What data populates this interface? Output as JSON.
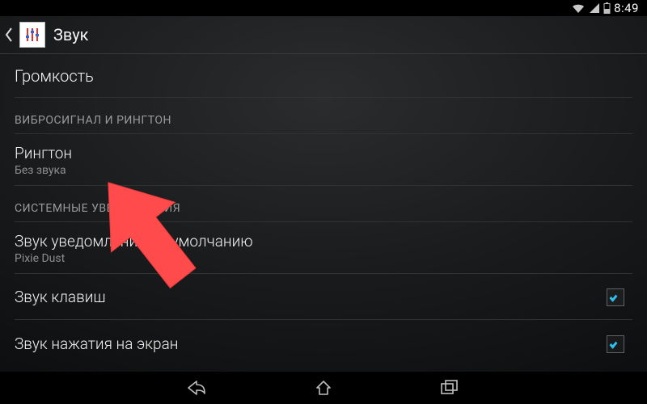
{
  "statusbar": {
    "time": "8:49"
  },
  "actionbar": {
    "title": "Звук"
  },
  "rows": {
    "volume": {
      "label": "Громкость"
    },
    "catVibrate": {
      "label": "ВИБРОСИГНАЛ И РИНГТОН"
    },
    "ringtone": {
      "label": "Рингтон",
      "sub": "Без звука"
    },
    "catSystem": {
      "label": "СИСТЕМНЫЕ УВЕДОМЛЕНИЯ"
    },
    "defaultNotif": {
      "label": "Звук уведомлений по умолчанию",
      "sub": "Pixie Dust"
    },
    "dialpad": {
      "label": "Звук клавиш"
    },
    "touch": {
      "label": "Звук нажатия на экран"
    }
  }
}
